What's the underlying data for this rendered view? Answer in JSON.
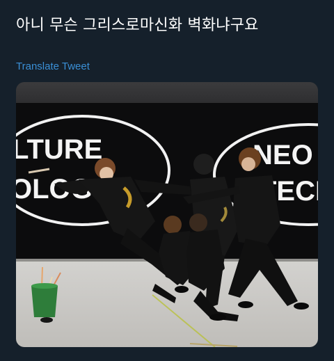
{
  "tweet": {
    "text": "아니 무슨 그리스로마신화 벽화냐구요",
    "translate_label": "Translate Tweet"
  },
  "media": {
    "wall_text_left_top": "LTURE",
    "wall_text_left_bottom": "OLOG",
    "wall_text_right_top": "NEO",
    "wall_text_right_bottom": "TECH"
  },
  "colors": {
    "background": "#15202b",
    "text": "#ffffff",
    "link": "#3a8fd6"
  }
}
